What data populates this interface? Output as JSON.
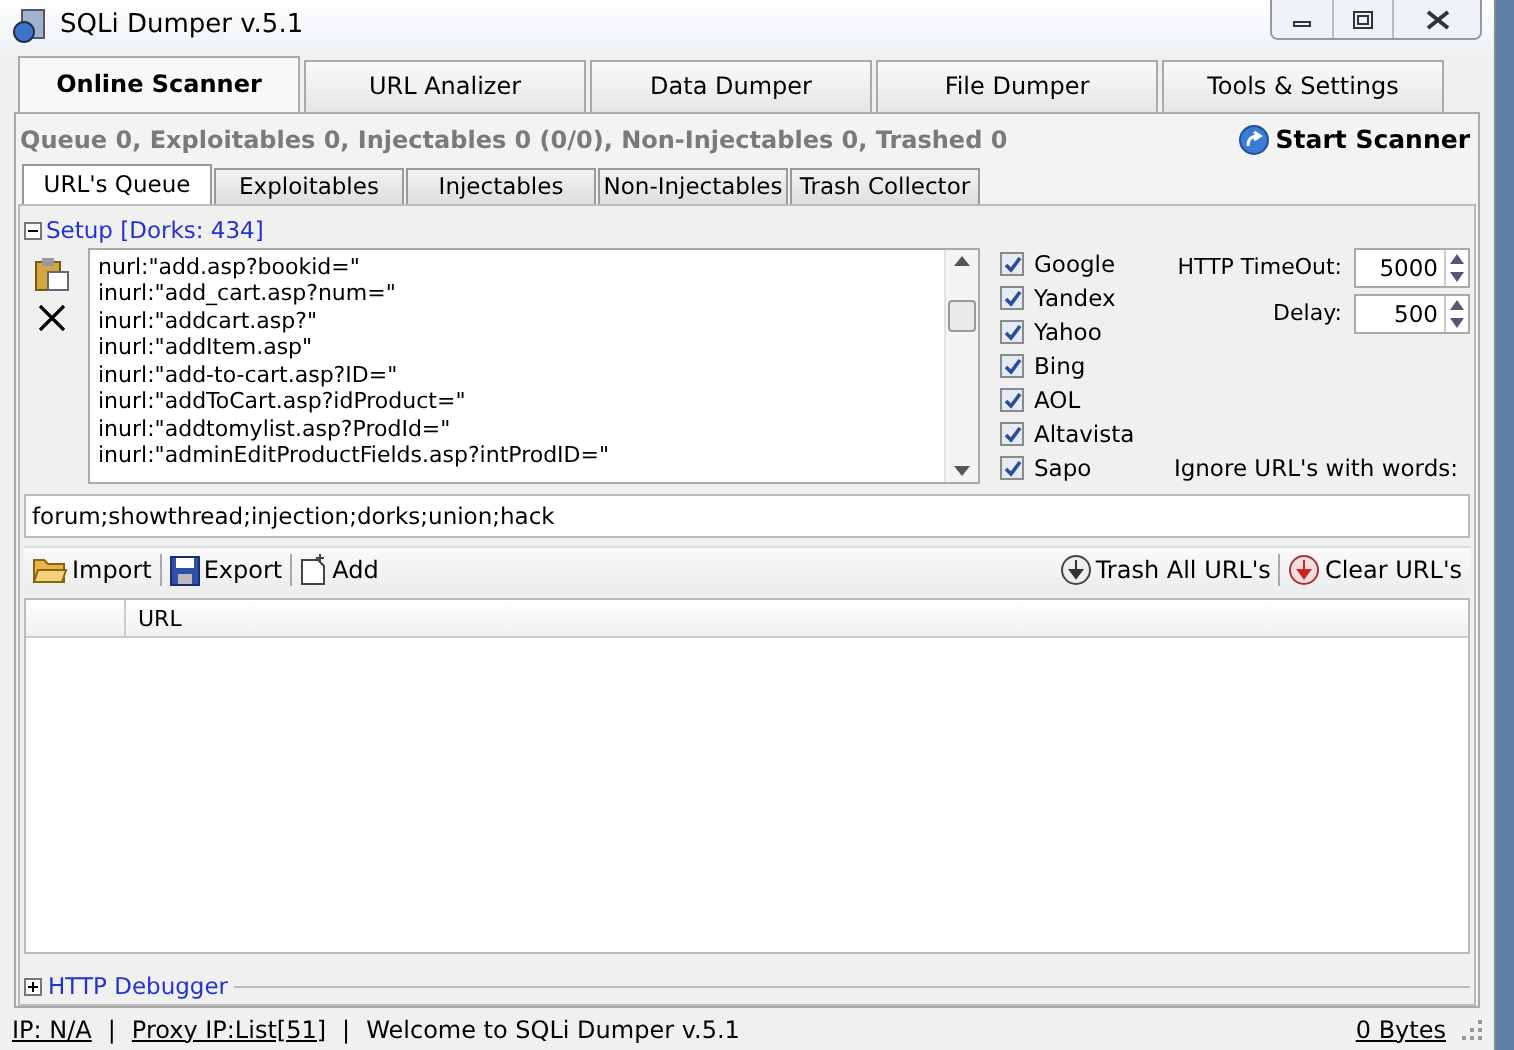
{
  "window": {
    "title": "SQLi Dumper v.5.1"
  },
  "tabs": [
    {
      "label": "Online Scanner",
      "selected": true
    },
    {
      "label": "URL Analizer",
      "selected": false
    },
    {
      "label": "Data Dumper",
      "selected": false
    },
    {
      "label": "File Dumper",
      "selected": false
    },
    {
      "label": "Tools & Settings",
      "selected": false
    }
  ],
  "summary": "Queue 0, Exploitables 0, Injectables 0 (0/0), Non-Injectables 0, Trashed 0",
  "start_button": "Start Scanner",
  "subtabs": [
    {
      "label": "URL's Queue",
      "selected": true
    },
    {
      "label": "Exploitables",
      "selected": false
    },
    {
      "label": "Injectables",
      "selected": false
    },
    {
      "label": "Non-Injectables",
      "selected": false
    },
    {
      "label": "Trash Collector",
      "selected": false
    }
  ],
  "setup": {
    "title": "Setup [Dorks: 434]",
    "expanded": true,
    "dorks": [
      "nurl:\"add.asp?bookid=\"",
      "inurl:\"add_cart.asp?num=\"",
      "inurl:\"addcart.asp?\"",
      "inurl:\"addItem.asp\"",
      "inurl:\"add-to-cart.asp?ID=\"",
      "inurl:\"addToCart.asp?idProduct=\"",
      "inurl:\"addtomylist.asp?ProdId=\"",
      "inurl:\"adminEditProductFields.asp?intProdID=\""
    ],
    "engines": [
      {
        "label": "Google",
        "checked": true
      },
      {
        "label": "Yandex",
        "checked": true
      },
      {
        "label": "Yahoo",
        "checked": true
      },
      {
        "label": "Bing",
        "checked": true
      },
      {
        "label": "AOL",
        "checked": true
      },
      {
        "label": "Altavista",
        "checked": true
      },
      {
        "label": "Sapo",
        "checked": true
      }
    ],
    "timeout": {
      "label": "HTTP TimeOut:",
      "value": "5000"
    },
    "delay": {
      "label": "Delay:",
      "value": "500"
    },
    "ignore_label": "Ignore URL's with words:",
    "ignore_words": "forum;showthread;injection;dorks;union;hack"
  },
  "toolbar": {
    "left": [
      "Import",
      "Export",
      "Add"
    ],
    "right": [
      "Trash All URL's",
      "Clear URL's"
    ]
  },
  "table": {
    "columns": [
      "URL"
    ]
  },
  "debugger": {
    "title": "HTTP Debugger",
    "expanded": false
  },
  "status_bar": {
    "separator": "|",
    "ip": "IP: N/A",
    "proxy": "Proxy IP:List[51]",
    "message": "Welcome to SQLi Dumper v.5.1",
    "bytes": "0 Bytes"
  }
}
